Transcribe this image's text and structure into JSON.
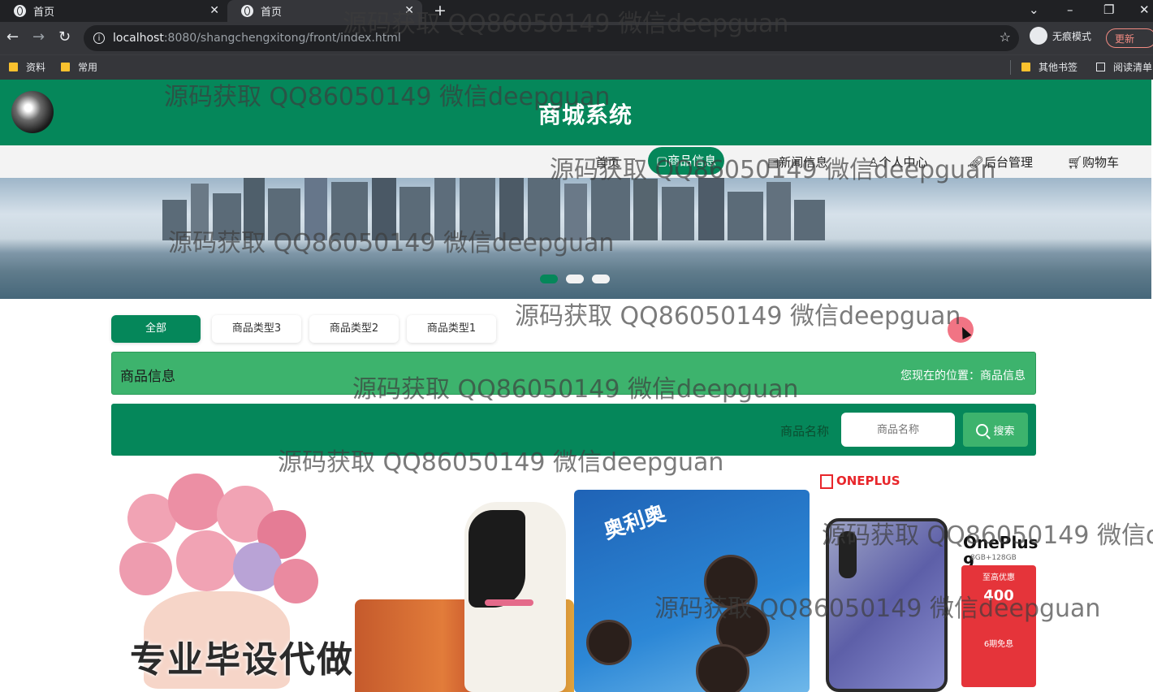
{
  "browser": {
    "tabs": [
      {
        "title": "首页"
      },
      {
        "title": "首页"
      }
    ],
    "url_host": "localhost",
    "url_path": ":8080/shangchengxitong/front/index.html",
    "incognito_label": "无痕模式",
    "update_label": "更新",
    "bookmarks": [
      "资料",
      "常用"
    ],
    "bookmarks_right": [
      "其他书签",
      "阅读清单"
    ]
  },
  "site": {
    "title": "商城系统"
  },
  "nav": {
    "items": [
      {
        "label": "首页"
      },
      {
        "label": "商品信息"
      },
      {
        "label": "新闻信息"
      },
      {
        "label": "个人中心"
      },
      {
        "label": "后台管理"
      },
      {
        "label": "购物车"
      }
    ],
    "active": "商品信息"
  },
  "carousel": {
    "slides": 3,
    "active_index": 0
  },
  "categories": [
    "全部",
    "商品类型3",
    "商品类型2",
    "商品类型1"
  ],
  "breadcrumb": {
    "section": "商品信息",
    "location_label": "您现在的位置：",
    "location_value": "商品信息"
  },
  "search": {
    "label": "商品名称",
    "placeholder": "商品名称",
    "button": "搜索"
  },
  "products_banner": {
    "brand": "ONEPLUS",
    "phone_model": "OnePlus 9",
    "phone_spec": "8GB+128GB",
    "oreo_title": "奥利奥",
    "promo_line1": "至高优惠",
    "promo_line2": "400",
    "promo_line3": "6期免息",
    "overlay_text": "专业毕设代做"
  },
  "watermark": {
    "text": "源码获取 QQ86050149 微信deepguan",
    "partial": "源码获取 QQ86050149 微信d"
  },
  "colors": {
    "primary": "#05875a",
    "secondary": "#3db36d",
    "chrome_dark": "#202124",
    "chrome_mid": "#35363a"
  }
}
